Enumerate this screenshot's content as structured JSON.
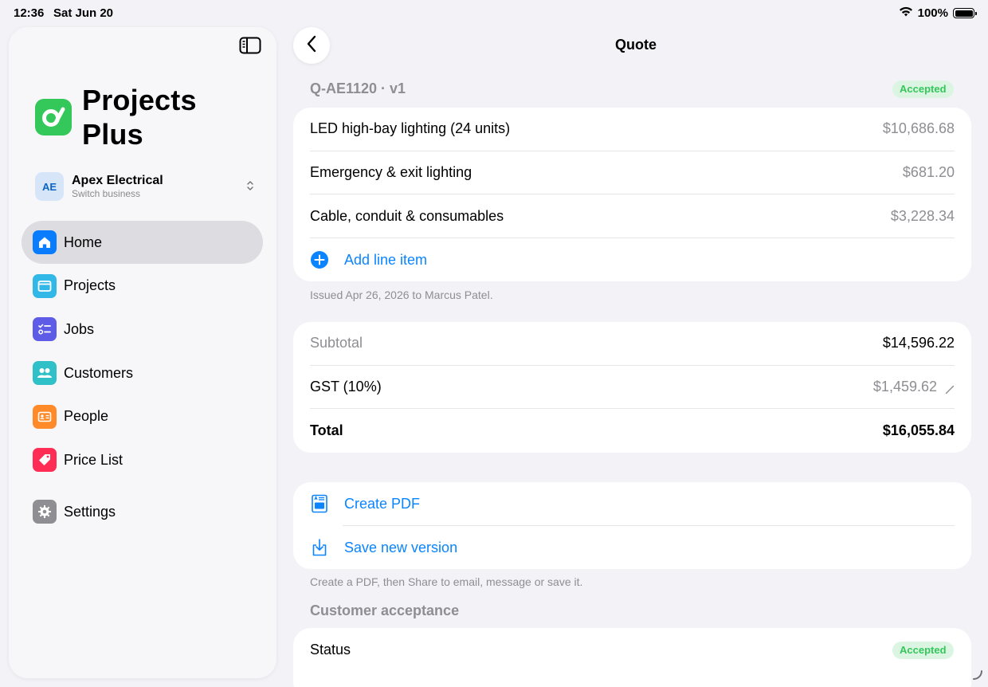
{
  "status_bar": {
    "time": "12:36",
    "date": "Sat Jun 20",
    "battery": "100%"
  },
  "sidebar": {
    "app_name": "Projects Plus",
    "app_name_line1": "Projects",
    "app_name_line2": "Plus",
    "business": {
      "initials": "AE",
      "name": "Apex Electrical",
      "subtitle": "Switch business"
    },
    "items": [
      {
        "label": "Home",
        "icon": "house-icon",
        "color": "#0a7cff",
        "active": true
      },
      {
        "label": "Projects",
        "icon": "folder-icon",
        "color": "#32b8e6"
      },
      {
        "label": "Jobs",
        "icon": "checklist-icon",
        "color": "#5e5ce6"
      },
      {
        "label": "Customers",
        "icon": "people-icon",
        "color": "#30c0c8"
      },
      {
        "label": "People",
        "icon": "id-card-icon",
        "color": "#ff8a2a"
      },
      {
        "label": "Price List",
        "icon": "tag-icon",
        "color": "#ff2d55"
      },
      {
        "label": "Settings",
        "icon": "gear-icon",
        "color": "#8e8e93"
      }
    ]
  },
  "header": {
    "title": "Quote"
  },
  "quote": {
    "id": "Q-AE1120 · v1",
    "status": "Accepted",
    "line_items": [
      {
        "description": "LED high-bay lighting (24 units)",
        "amount": "$10,686.68"
      },
      {
        "description": "Emergency & exit lighting",
        "amount": "$681.20"
      },
      {
        "description": "Cable, conduit & consumables",
        "amount": "$3,228.34"
      }
    ],
    "add_line_item": "Add line item",
    "issued_note": "Issued Apr 26, 2026 to Marcus Patel.",
    "totals": {
      "subtotal_label": "Subtotal",
      "subtotal": "$14,596.22",
      "gst_label": "GST (10%)",
      "gst": "$1,459.62",
      "total_label": "Total",
      "total": "$16,055.84"
    },
    "actions": {
      "create_pdf": "Create PDF",
      "save_version": "Save new version"
    },
    "actions_note": "Create a PDF, then Share to email, message or save it.",
    "acceptance": {
      "heading": "Customer acceptance",
      "status_label": "Status",
      "status": "Accepted"
    }
  },
  "colors": {
    "accent": "#0a84ff",
    "brand": "#34c759",
    "accepted_bg": "#dcf5e3",
    "accepted_text": "#34c759"
  }
}
